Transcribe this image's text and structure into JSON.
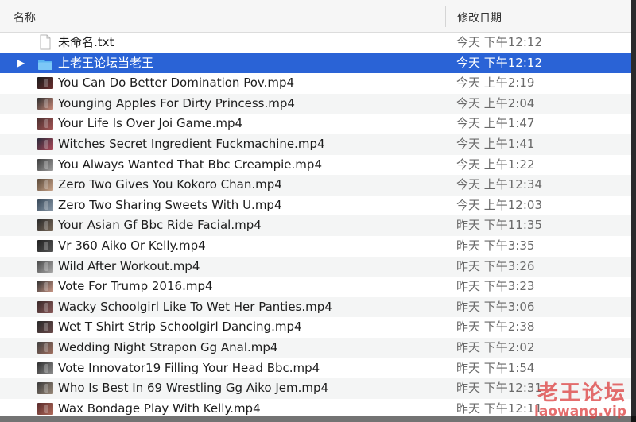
{
  "header": {
    "name_label": "名称",
    "date_label": "修改日期"
  },
  "files": [
    {
      "name": "未命名.txt",
      "date": "今天 下午12:12",
      "kind": "document",
      "selected": false
    },
    {
      "name": "上老王论坛当老王",
      "date": "今天 下午12:12",
      "kind": "folder",
      "selected": true
    },
    {
      "name": "You Can Do Better Domination Pov.mp4",
      "date": "今天 上午2:19",
      "kind": "video",
      "selected": false
    },
    {
      "name": "Younging Apples For Dirty Princess.mp4",
      "date": "今天 上午2:04",
      "kind": "video",
      "selected": false
    },
    {
      "name": "Your Life Is Over  Joi Game.mp4",
      "date": "今天 上午1:47",
      "kind": "video",
      "selected": false
    },
    {
      "name": "Witches Secret Ingredient Fuckmachine.mp4",
      "date": "今天 上午1:41",
      "kind": "video",
      "selected": false
    },
    {
      "name": "You Always Wanted That Bbc Creampie.mp4",
      "date": "今天 上午1:22",
      "kind": "video",
      "selected": false
    },
    {
      "name": "Zero Two Gives You Kokoro Chan.mp4",
      "date": "今天 上午12:34",
      "kind": "video",
      "selected": false
    },
    {
      "name": "Zero Two Sharing Sweets With U.mp4",
      "date": "今天 上午12:03",
      "kind": "video",
      "selected": false
    },
    {
      "name": "Your Asian Gf Bbc Ride Facial.mp4",
      "date": "昨天 下午11:35",
      "kind": "video",
      "selected": false
    },
    {
      "name": "Vr 360 Aiko Or Kelly.mp4",
      "date": "昨天 下午3:35",
      "kind": "video",
      "selected": false
    },
    {
      "name": "Wild After Workout.mp4",
      "date": "昨天 下午3:26",
      "kind": "video",
      "selected": false
    },
    {
      "name": "Vote For Trump 2016.mp4",
      "date": "昨天 下午3:23",
      "kind": "video",
      "selected": false
    },
    {
      "name": "Wacky Schoolgirl Like To Wet Her Panties.mp4",
      "date": "昨天 下午3:06",
      "kind": "video",
      "selected": false
    },
    {
      "name": "Wet T Shirt Strip Schoolgirl Dancing.mp4",
      "date": "昨天 下午2:38",
      "kind": "video",
      "selected": false
    },
    {
      "name": "Wedding Night Strapon Gg Anal.mp4",
      "date": "昨天 下午2:02",
      "kind": "video",
      "selected": false
    },
    {
      "name": "Vote Innovator19 Filling Your Head Bbc.mp4",
      "date": "昨天 下午1:54",
      "kind": "video",
      "selected": false
    },
    {
      "name": "Who Is Best In 69 Wrestling Gg Aiko Jem.mp4",
      "date": "昨天 下午12:31",
      "kind": "video",
      "selected": false
    },
    {
      "name": "Wax Bondage Play With Kelly.mp4",
      "date": "昨天 下午12:11",
      "kind": "video",
      "selected": false
    }
  ],
  "watermark": {
    "title": "老王论坛",
    "url": "laowang.vip"
  },
  "colors": {
    "selection": "#2a63d6",
    "folder": "#5ab4f2",
    "alternate_row": "#f4f5f5",
    "watermark": "#dc3c3c"
  }
}
